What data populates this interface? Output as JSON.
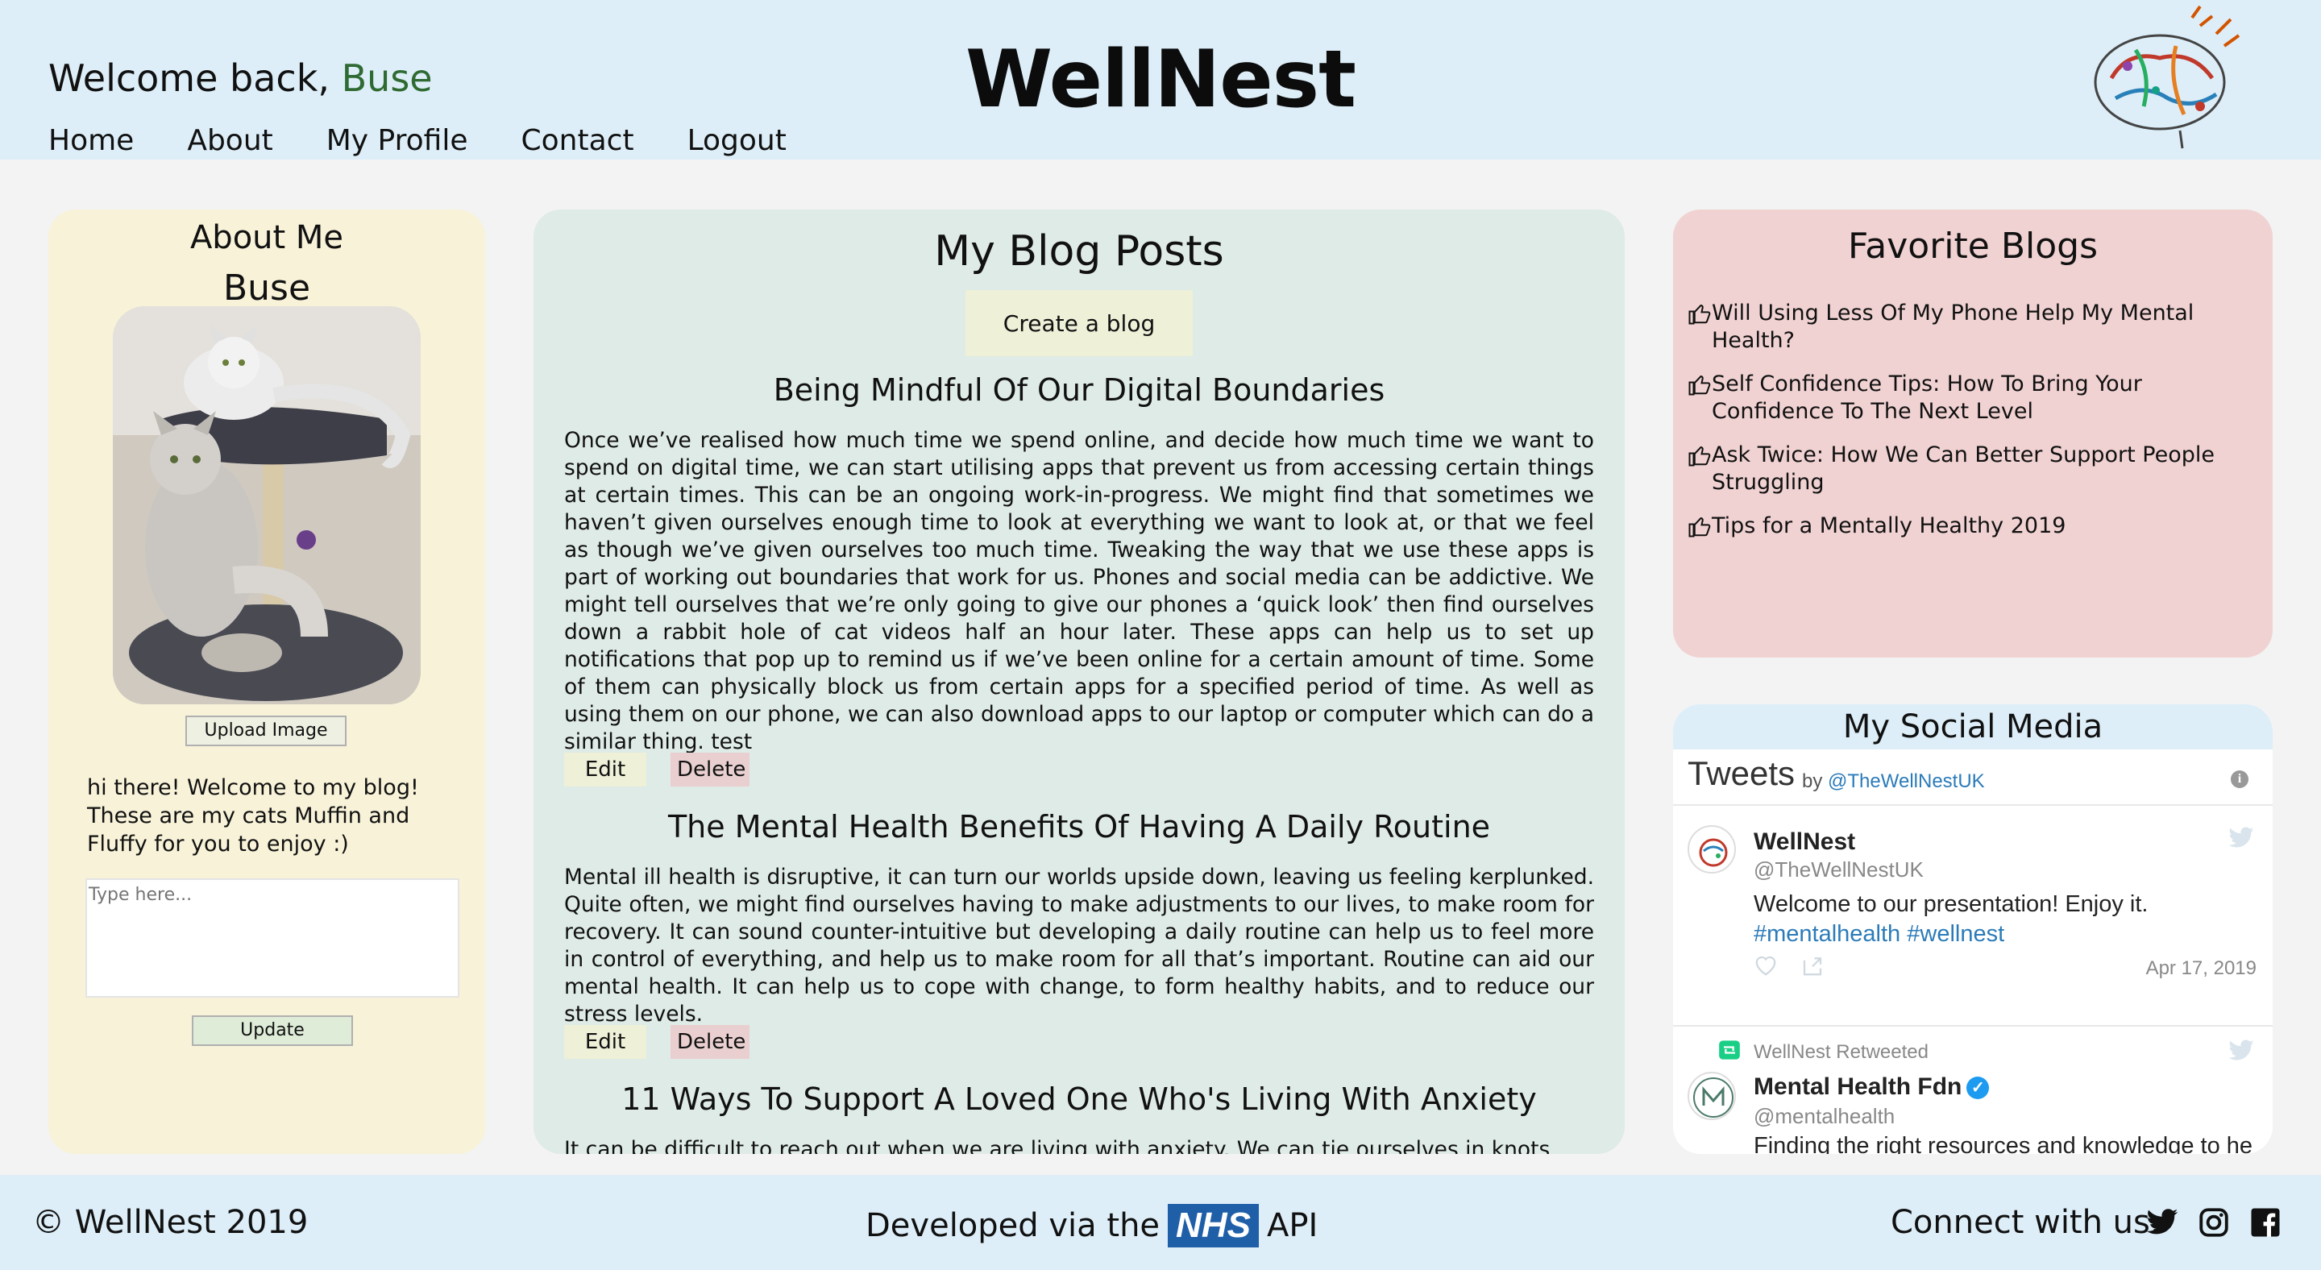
{
  "header": {
    "welcome_prefix": "Welcome back,",
    "username": "Buse",
    "brand": "WellNest",
    "nav": [
      "Home",
      "About",
      "My Profile",
      "Contact",
      "Logout"
    ]
  },
  "about": {
    "title": "About Me",
    "name": "Buse",
    "upload_label": "Upload Image",
    "bio": "hi there! Welcome to my blog! These are my cats Muffin and Fluffy for you to enjoy :)",
    "input_placeholder": "Type here...",
    "update_label": "Update"
  },
  "blog": {
    "title": "My Blog Posts",
    "create_label": "Create a blog",
    "edit_label": "Edit",
    "delete_label": "Delete",
    "posts": [
      {
        "title": "Being Mindful Of Our Digital Boundaries",
        "body": "Once we’ve realised how much time we spend online, and decide how much time we want to spend on digital time, we can start utilising apps that prevent us from accessing certain things at certain times. This can be an ongoing work-in-progress. We might find that sometimes we haven’t given ourselves enough time to look at everything we want to look at, or that we feel as though we’ve given ourselves too much time. Tweaking the way that we use these apps is part of working out boundaries that work for us. Phones and social media can be addictive. We might tell ourselves that we’re only going to give our phones a ‘quick look’ then find ourselves down a rabbit hole of cat videos half an hour later. These apps can help us to set up notifications that pop up to remind us if we’ve been online for a certain amount of time. Some of them can physically block us from certain apps for a specified period of time. As well as using them on our phone, we can also download apps to our laptop or computer which can do a similar thing. test"
      },
      {
        "title": "The Mental Health Benefits Of Having A Daily Routine",
        "body": "Mental ill health is disruptive, it can turn our worlds upside down, leaving us feeling kerplunked. Quite often, we might find ourselves having to make adjustments to our lives, to make room for recovery. It can sound counter-intuitive but developing a daily routine can help us to feel more in control of everything, and help us to make room for all that’s important. Routine can aid our mental health. It can help us to cope with change, to form healthy habits, and to reduce our stress levels."
      },
      {
        "title": "11 Ways To Support A Loved One Who's Living With Anxiety",
        "body": "It can be difficult to reach out when we are living with anxiety. We can tie ourselves in knots"
      }
    ]
  },
  "favorites": {
    "title": "Favorite Blogs",
    "items": [
      "Will Using Less Of My Phone Help My Mental Health?",
      "Self Confidence Tips: How To Bring Your Confidence To The Next Level",
      "Ask Twice: How We Can Better Support People Struggling",
      "Tips for a Mentally Healthy 2019"
    ]
  },
  "social": {
    "title": "My Social Media",
    "tweets_label": "Tweets",
    "by_label": "by",
    "account_handle": "@TheWellNestUK",
    "tweet1": {
      "name": "WellNest",
      "handle": "@TheWellNestUK",
      "text": "Welcome to our presentation! Enjoy it.",
      "hashtags": "#mentalhealth #wellnest",
      "date": "Apr 17, 2019"
    },
    "tweet2": {
      "retweet_label": "WellNest Retweeted",
      "name": "Mental Health Fdn",
      "handle": "@mentalhealth",
      "text": "Finding the right resources and knowledge to help"
    }
  },
  "footer": {
    "copyright": "© WellNest 2019",
    "dev_prefix": "Developed via the",
    "nhs": "NHS",
    "dev_suffix": "API",
    "connect": "Connect with us:"
  },
  "colors": {
    "header_bg": "#ddeef8",
    "about_bg": "#f7f2d8",
    "blog_bg": "#dfebe6",
    "fav_bg": "#f1d2d2",
    "username_green": "#2e6a32",
    "nhs_blue": "#1f5fa8"
  }
}
